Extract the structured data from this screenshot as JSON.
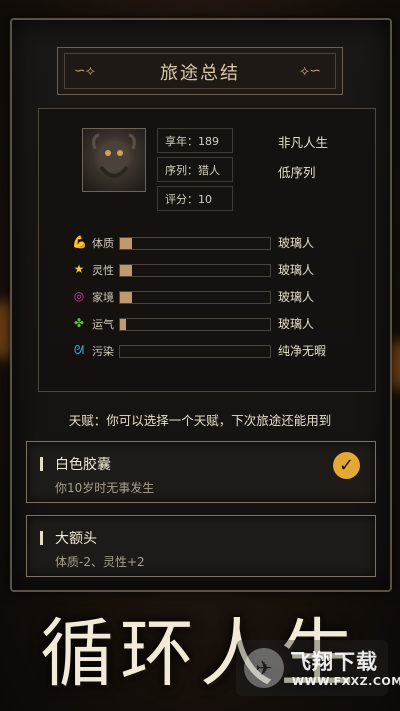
{
  "title": "旅途总结",
  "profile": {
    "age_field": "享年：189",
    "sequence_field": "序列：猎人",
    "score_field": "评分：10",
    "tag_life": "非凡人生",
    "tag_sequence": "低序列"
  },
  "stats": [
    {
      "icon": "muscle-icon",
      "name": "体质",
      "fraction": 0.08,
      "value": "玻璃人",
      "color": "#e0683a"
    },
    {
      "icon": "star-icon",
      "name": "灵性",
      "fraction": 0.08,
      "value": "玻璃人",
      "color": "#f0c43a"
    },
    {
      "icon": "swirl-icon",
      "name": "家境",
      "fraction": 0.08,
      "value": "玻璃人",
      "color": "#d63aa0"
    },
    {
      "icon": "clover-icon",
      "name": "运气",
      "fraction": 0.04,
      "value": "玻璃人",
      "color": "#5bbf3a"
    },
    {
      "icon": "pollution-icon",
      "name": "污染",
      "fraction": 0.0,
      "value": "纯净无暇",
      "color": "#3aa6d6"
    }
  ],
  "talent_note": "天赋：你可以选择一个天赋，下次旅途还能用到",
  "talents": [
    {
      "name": "白色胶囊",
      "desc": "你10岁时无事发生",
      "selected": true
    },
    {
      "name": "大额头",
      "desc": "体质-2、灵性+2",
      "selected": false
    }
  ],
  "banner_title": "循环人生",
  "watermark": {
    "name": "飞翔下载",
    "url": "WWW.FXXZ.COM"
  }
}
